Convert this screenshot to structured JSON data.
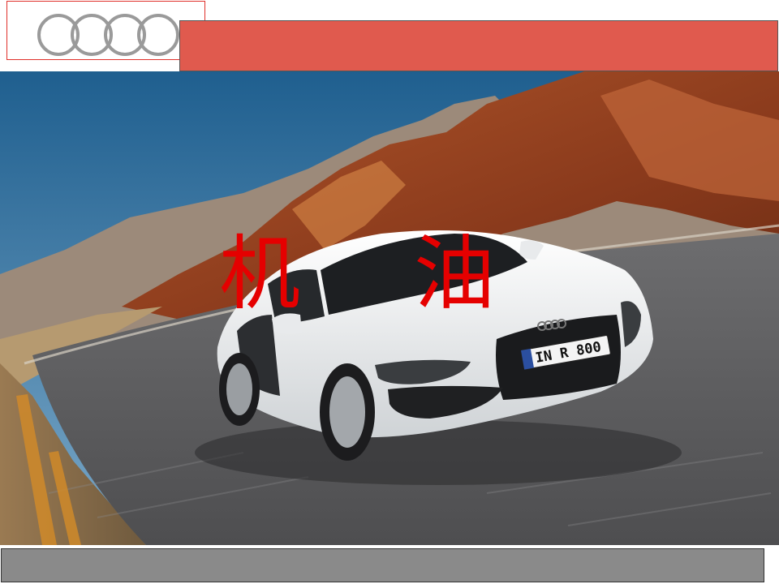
{
  "brand": {
    "logo_icon": "four-rings-logo-icon",
    "ring_color": "#9a9a9a",
    "frame_color": "#e0302a"
  },
  "header": {
    "bar_color": "#e05a4e"
  },
  "hero": {
    "image_icon": "sports-car-on-desert-road-photo",
    "title_chars": [
      "机",
      "油"
    ],
    "title_color": "#e50000",
    "license_plate": "IN R 800"
  },
  "footer": {
    "bar_color": "#8a8a8a"
  }
}
